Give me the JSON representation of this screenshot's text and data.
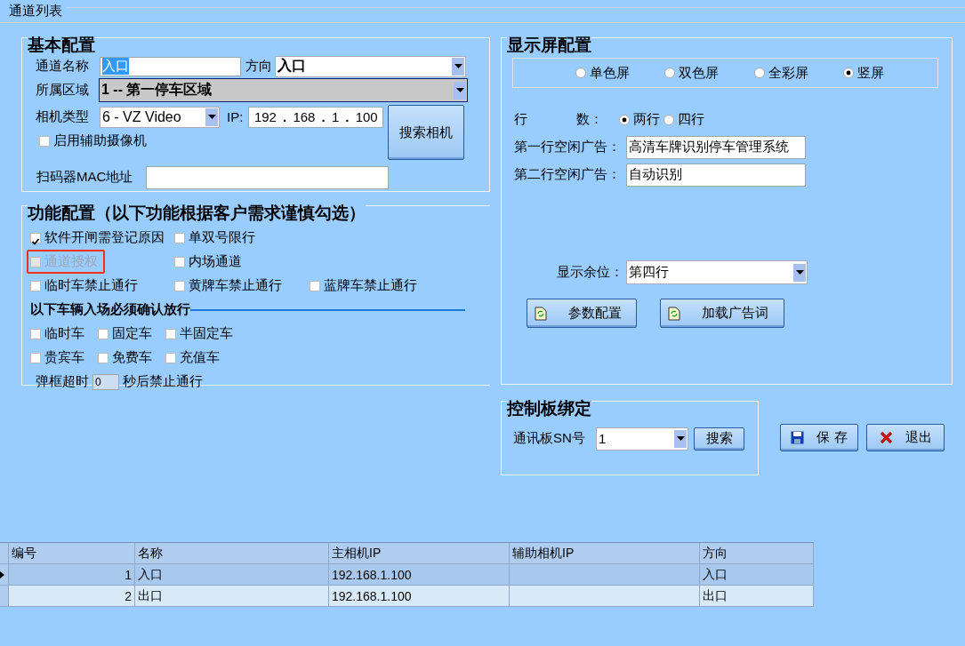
{
  "section_title": "通道列表",
  "basic_config": {
    "title": "基本配置",
    "channel_name": {
      "label": "通道名称",
      "value": "入口",
      "text_selected": true
    },
    "direction": {
      "label": "方向",
      "value": "入口"
    },
    "area": {
      "label": "所属区域",
      "value": "1 -- 第一停车区域"
    },
    "camera_type": {
      "label": "相机类型",
      "value": "6 - VZ Video"
    },
    "ip": {
      "label": "IP:",
      "octets": [
        "192",
        "168",
        "1",
        "100"
      ],
      "separators": [
        ".",
        ".",
        "."
      ]
    },
    "search_camera_button": "搜索相机",
    "aux_camera": {
      "label": "启用辅助摄像机",
      "checked": false
    },
    "scanner_mac": {
      "label": "扫码器MAC地址"
    }
  },
  "function_config": {
    "title": "功能配置（以下功能根据客户需求谨慎勾选）",
    "rows": [
      {
        "items": [
          {
            "label": "软件开闸需登记原因",
            "checked": true,
            "disabled": false,
            "highlighted": false
          },
          {
            "label": "单双号限行",
            "checked": false,
            "disabled": false,
            "highlighted": false
          }
        ]
      },
      {
        "items": [
          {
            "label": "通道授权",
            "checked": false,
            "disabled": true,
            "highlighted": true
          },
          {
            "label": "内场通道",
            "checked": false,
            "disabled": false,
            "highlighted": false
          }
        ]
      },
      {
        "items": [
          {
            "label": "临时车禁止通行",
            "checked": false,
            "disabled": false,
            "highlighted": false
          },
          {
            "label": "黄牌车禁止通行",
            "checked": false,
            "disabled": false,
            "highlighted": false
          },
          {
            "label": "蓝牌车禁止通行",
            "checked": false,
            "disabled": false,
            "highlighted": false
          }
        ]
      }
    ],
    "confirm_heading": "以下车辆入场必须确认放行",
    "vehicle_rows": [
      {
        "items": [
          {
            "label": "临时车",
            "checked": false
          },
          {
            "label": "固定车",
            "checked": false
          },
          {
            "label": "半固定车",
            "checked": false
          }
        ]
      },
      {
        "items": [
          {
            "label": "贵宾车",
            "checked": false
          },
          {
            "label": "免费车",
            "checked": false
          },
          {
            "label": "充值车",
            "checked": false
          }
        ]
      }
    ],
    "timeout": {
      "label": "弹框超时",
      "value": "0",
      "suffix": "秒后禁止通行"
    }
  },
  "display_config": {
    "title": "显示屏配置",
    "screen_types": [
      {
        "label": "单色屏",
        "selected": false
      },
      {
        "label": "双色屏",
        "selected": false
      },
      {
        "label": "全彩屏",
        "selected": false
      },
      {
        "label": "竖屏",
        "selected": true
      }
    ],
    "line_count": {
      "label_left": "行",
      "label_right": "数：",
      "options": [
        {
          "label": "两行",
          "selected": true
        },
        {
          "label": "四行",
          "selected": false
        }
      ]
    },
    "ad_line_1": {
      "label": "第一行空闲广告：",
      "value": "高清车牌识别停车管理系统"
    },
    "ad_line_2": {
      "label": "第二行空闲广告：",
      "value": "自动识别"
    },
    "spare_position": {
      "label": "显示余位：",
      "value": "第四行"
    },
    "buttons": [
      {
        "label": "参数配置"
      },
      {
        "label": "加载广告词"
      }
    ]
  },
  "control_board": {
    "title": "控制板绑定",
    "sn": {
      "label": "通讯板SN号",
      "value": "1"
    },
    "search_button": "搜索"
  },
  "actions": [
    {
      "kind": "save",
      "label": "保 存"
    },
    {
      "kind": "exit",
      "label": "退出"
    }
  ],
  "table": {
    "columns": [
      "编号",
      "名称",
      "主相机IP",
      "辅助相机IP",
      "方向"
    ],
    "rows": [
      {
        "selected": true,
        "number": "1",
        "name": "入口",
        "main_ip": "192.168.1.100",
        "direction": "入口"
      },
      {
        "selected": false,
        "number": "2",
        "name": "出口",
        "main_ip": "192.168.1.100",
        "direction": "出口"
      }
    ]
  }
}
